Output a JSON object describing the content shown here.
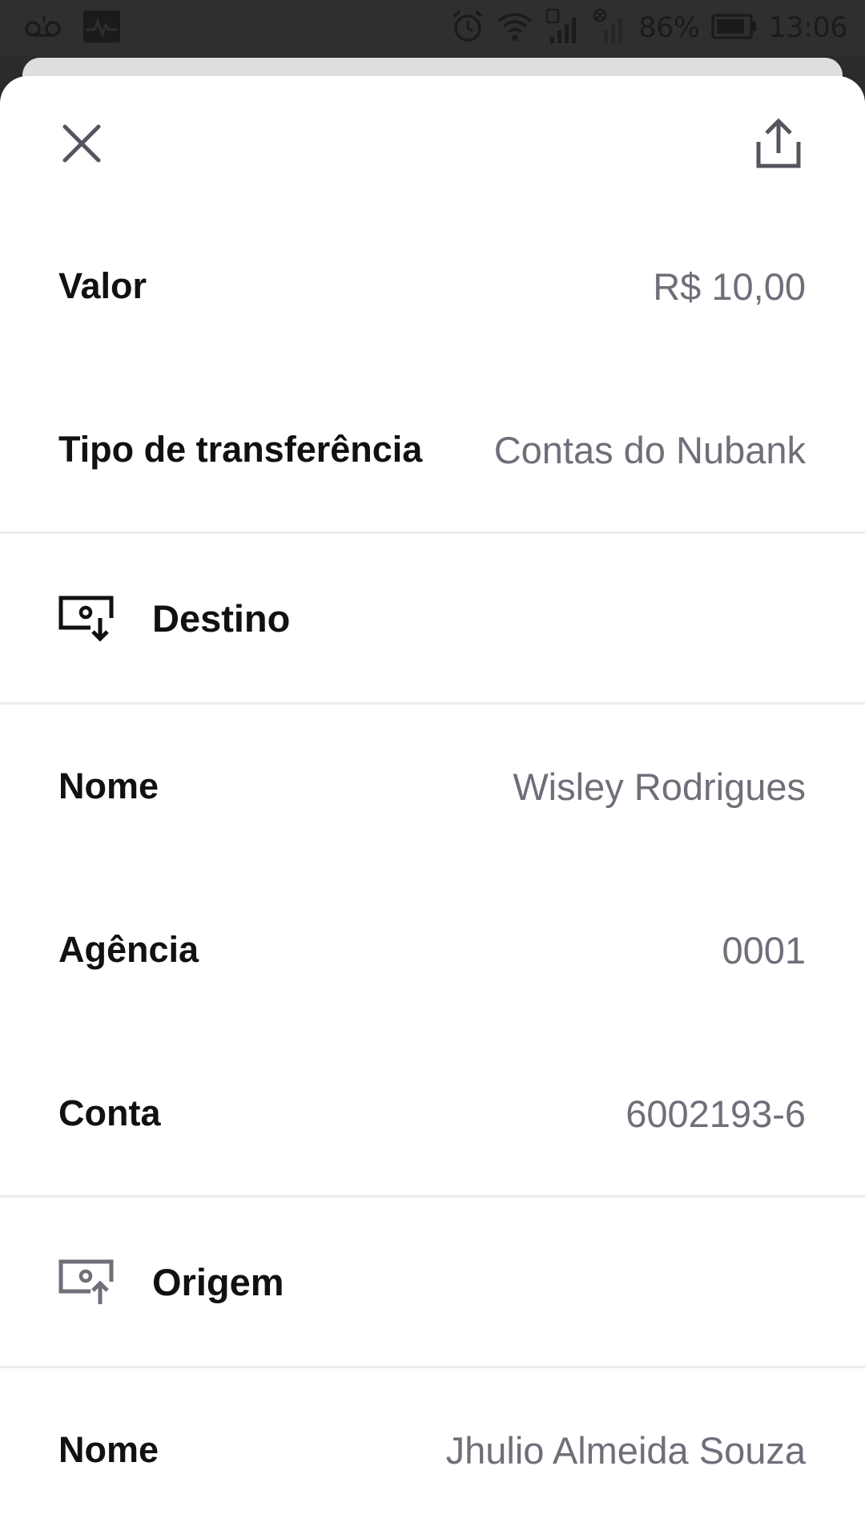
{
  "status_bar": {
    "battery": "86%",
    "time": "13:06",
    "icons": [
      "voicemail-icon",
      "activity-icon",
      "alarm-icon",
      "wifi-icon",
      "signal-sim1-icon",
      "signal-sim2-no-service-icon",
      "battery-icon"
    ]
  },
  "header": {
    "close_icon": "close-icon",
    "share_icon": "share-icon"
  },
  "summary": {
    "valor_label": "Valor",
    "valor_value": "R$ 10,00",
    "tipo_label": "Tipo de transferência",
    "tipo_value": "Contas do Nubank"
  },
  "destino": {
    "title": "Destino",
    "icon": "money-in-icon",
    "nome_label": "Nome",
    "nome_value": "Wisley Rodrigues",
    "agencia_label": "Agência",
    "agencia_value": "0001",
    "conta_label": "Conta",
    "conta_value": "6002193-6"
  },
  "origem": {
    "title": "Origem",
    "icon": "money-out-icon",
    "nome_label": "Nome",
    "nome_value": "Jhulio Almeida Souza"
  },
  "colors": {
    "label": "#111111",
    "value": "#6f6f7a",
    "divider": "#ececec",
    "status_bar": "#2f2f2f"
  }
}
